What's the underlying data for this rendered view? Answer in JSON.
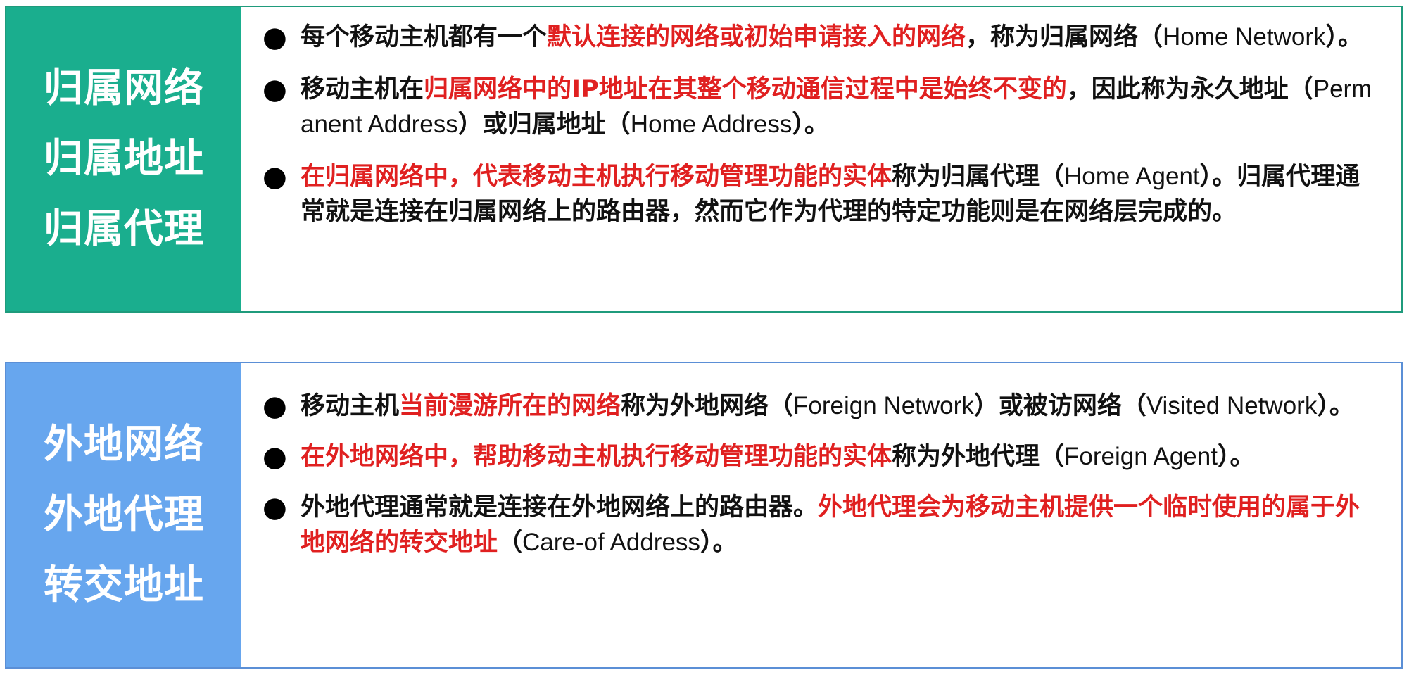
{
  "bullet_char": "●",
  "home": {
    "labels": [
      "归属网络",
      "归属地址",
      "归属代理"
    ],
    "bullets": [
      [
        {
          "text": "每个移动主机都有一个"
        },
        {
          "text": "默认连接的网络或初始申请接入的网络",
          "red": true
        },
        {
          "text": "，称为归属网络（"
        },
        {
          "text": "Home Network",
          "latin": true
        },
        {
          "text": "）。"
        }
      ],
      [
        {
          "text": "移动主机在"
        },
        {
          "text": "归属网络中的IP地址在其整个移动通信过程中是始终不变的",
          "red": true
        },
        {
          "text": "，因此称为永久地址（"
        },
        {
          "text": "Permanent Address",
          "latin": true
        },
        {
          "text": "）或归属地址（"
        },
        {
          "text": "Home Address",
          "latin": true
        },
        {
          "text": "）。"
        }
      ],
      [
        {
          "text": "在归属网络中，代表移动主机执行移动管理功能的实体",
          "red": true
        },
        {
          "text": "称为归属代理（"
        },
        {
          "text": "Home Agent",
          "latin": true
        },
        {
          "text": "）。归属代理通常就是连接在归属网络上的路由器，然而它作为代理的特定功能则是在网络层完成的。"
        }
      ]
    ]
  },
  "foreign": {
    "labels": [
      "外地网络",
      "外地代理",
      "转交地址"
    ],
    "bullets": [
      [
        {
          "text": "移动主机"
        },
        {
          "text": "当前漫游所在的网络",
          "red": true
        },
        {
          "text": "称为外地网络（"
        },
        {
          "text": "Foreign Network",
          "latin": true
        },
        {
          "text": "）或被访网络（"
        },
        {
          "text": "Visited Network",
          "latin": true
        },
        {
          "text": "）。"
        }
      ],
      [
        {
          "text": "在外地网络中，帮助移动主机执行移动管理功能的实体",
          "red": true
        },
        {
          "text": "称为外地代理（"
        },
        {
          "text": "Foreign Agent",
          "latin": true
        },
        {
          "text": "）。"
        }
      ],
      [
        {
          "text": "外地代理通常就是连接在外地网络上的路由器。"
        },
        {
          "text": "外地代理会为移动主机提供一个临时使用的属于外地网络的转交地址",
          "red": true
        },
        {
          "text": "（"
        },
        {
          "text": "Care-of Address",
          "latin": true
        },
        {
          "text": "）。"
        }
      ]
    ]
  }
}
